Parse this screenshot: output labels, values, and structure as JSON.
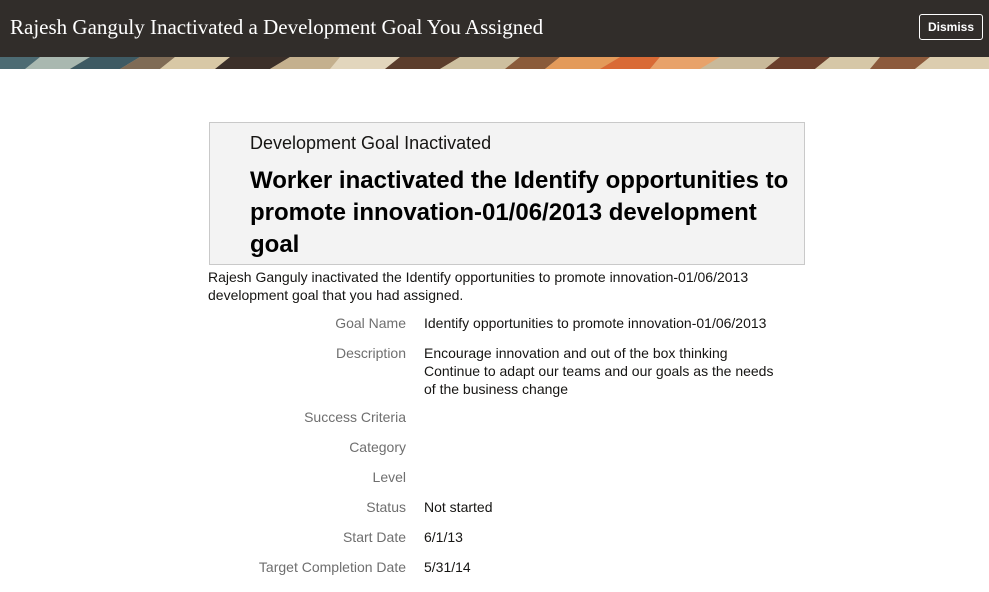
{
  "header": {
    "title": "Rajesh Ganguly Inactivated a Development Goal You Assigned",
    "dismiss_label": "Dismiss",
    "background": "#312d2a"
  },
  "card": {
    "subtitle": "Development Goal Inactivated",
    "title": "Worker inactivated the Identify opportunities to promote innovation-01/06/2013 development goal"
  },
  "intro": "Rajesh Ganguly inactivated the Identify opportunities to promote innovation-01/06/2013 development goal that you had assigned.",
  "details": {
    "goal_name": {
      "label": "Goal Name",
      "value": "Identify opportunities to promote innovation-01/06/2013"
    },
    "description": {
      "label": "Description",
      "lines": [
        "Encourage innovation and out of the box thinking",
        "Continue to adapt our teams and our goals as the needs",
        "of the business change"
      ]
    },
    "success_criteria": {
      "label": "Success Criteria",
      "value": ""
    },
    "category": {
      "label": "Category",
      "value": ""
    },
    "level": {
      "label": "Level",
      "value": ""
    },
    "status": {
      "label": "Status",
      "value": "Not started"
    },
    "start_date": {
      "label": "Start Date",
      "value": "6/1/13"
    },
    "target_completion_date": {
      "label": "Target Completion Date",
      "value": "5/31/14"
    }
  }
}
